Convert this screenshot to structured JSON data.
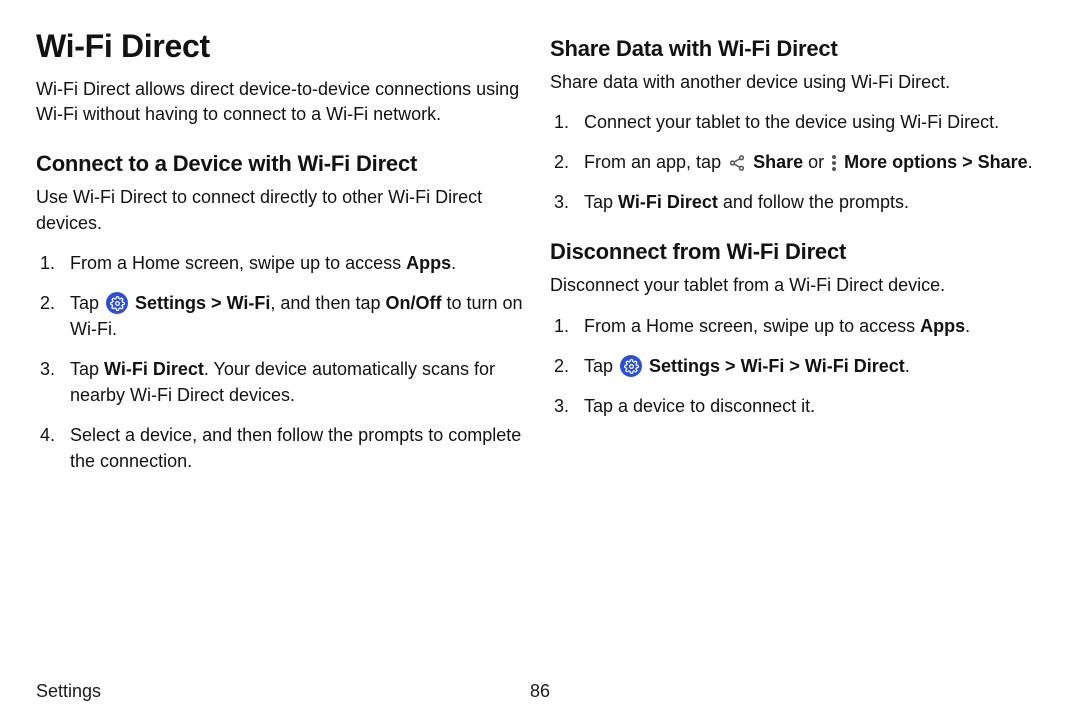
{
  "left": {
    "h1": "Wi-Fi Direct",
    "intro": "Wi-Fi Direct allows direct device-to-device connections using Wi-Fi without having to connect to a Wi-Fi network.",
    "h2": "Connect to a Device with Wi-Fi Direct",
    "lead": "Use Wi-Fi Direct to connect directly to other Wi-Fi Direct devices.",
    "s1a": "From a Home screen, swipe up to access ",
    "s1b": "Apps",
    "s1c": ".",
    "s2a": "Tap ",
    "s2b": " Settings",
    "s2c": " > ",
    "s2d": "Wi-Fi",
    "s2e": ", and then tap ",
    "s2f": "On/Off",
    "s2g": " to turn on Wi-Fi.",
    "s3a": "Tap ",
    "s3b": "Wi-Fi Direct",
    "s3c": ". Your device automatically scans for nearby Wi-Fi Direct devices.",
    "s4": "Select a device, and then follow the prompts to complete the connection."
  },
  "right": {
    "h2a": "Share Data with Wi-Fi Direct",
    "leada": "Share data with another device using Wi-Fi Direct.",
    "a1": "Connect your tablet to the device using Wi-Fi Direct.",
    "a2a": "From an app, tap ",
    "a2b": " Share",
    "a2c": " or ",
    "a2d": " More options",
    "a2e": " > ",
    "a2f": "Share",
    "a2g": ".",
    "a3a": "Tap ",
    "a3b": "Wi-Fi Direct",
    "a3c": " and follow the prompts.",
    "h2b": "Disconnect from Wi-Fi Direct",
    "leadb": "Disconnect your tablet from a Wi-Fi Direct device.",
    "b1a": "From a Home screen, swipe up to access ",
    "b1b": "Apps",
    "b1c": ".",
    "b2a": "Tap ",
    "b2b": " Settings",
    "b2c": " > ",
    "b2d": "Wi-Fi",
    "b2e": " > ",
    "b2f": "Wi-Fi Direct",
    "b2g": ".",
    "b3": "Tap a device to disconnect it."
  },
  "footer": {
    "section": "Settings",
    "page": "86"
  }
}
